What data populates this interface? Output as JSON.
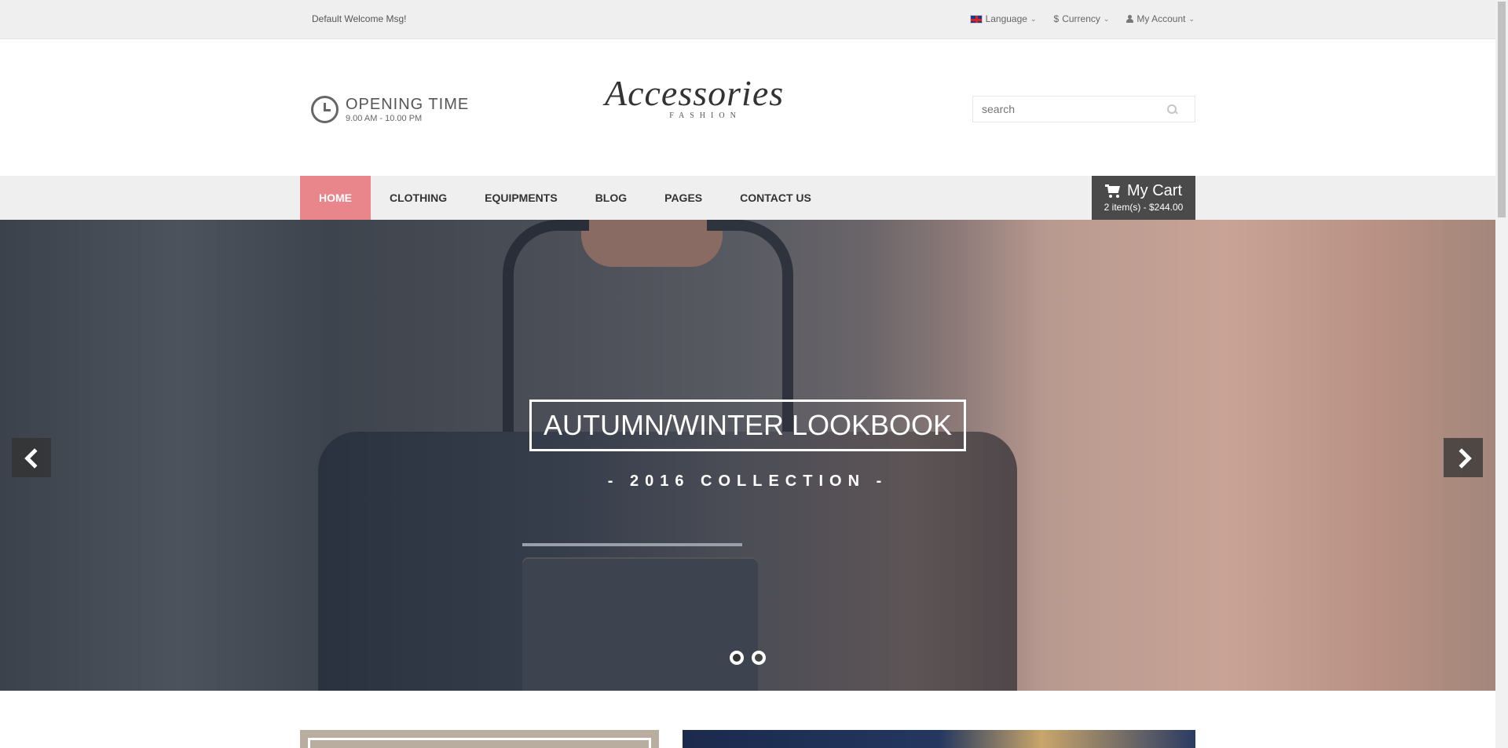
{
  "topbar": {
    "welcome": "Default Welcome Msg!",
    "language_label": "Language",
    "currency_symbol": "$",
    "currency_label": "Currency",
    "account_label": "My Account"
  },
  "header": {
    "opening_title": "OPENING TIME",
    "opening_hours": "9.00 AM - 10.00 PM",
    "logo_script": "Accessories",
    "logo_sub": "FASHION",
    "search_placeholder": "search"
  },
  "nav": {
    "items": [
      {
        "label": "HOME",
        "active": true
      },
      {
        "label": "CLOTHING",
        "active": false
      },
      {
        "label": "EQUIPMENTS",
        "active": false
      },
      {
        "label": "BLOG",
        "active": false
      },
      {
        "label": "PAGES",
        "active": false
      },
      {
        "label": "CONTACT US",
        "active": false
      }
    ],
    "active_color": "#e8868c"
  },
  "cart": {
    "label": "My Cart",
    "summary": "2 item(s) - $244.00"
  },
  "hero": {
    "title": "AUTUMN/WINTER LOOKBOOK",
    "subtitle": "- 2016 COLLECTION -",
    "slide_count": 2,
    "active_slide": 1
  },
  "icons": {
    "language": "uk-flag-icon",
    "account": "user-icon",
    "clock": "clock-icon",
    "search": "search-icon",
    "cart": "shopping-cart-icon",
    "prev": "chevron-left-icon",
    "next": "chevron-right-icon"
  }
}
